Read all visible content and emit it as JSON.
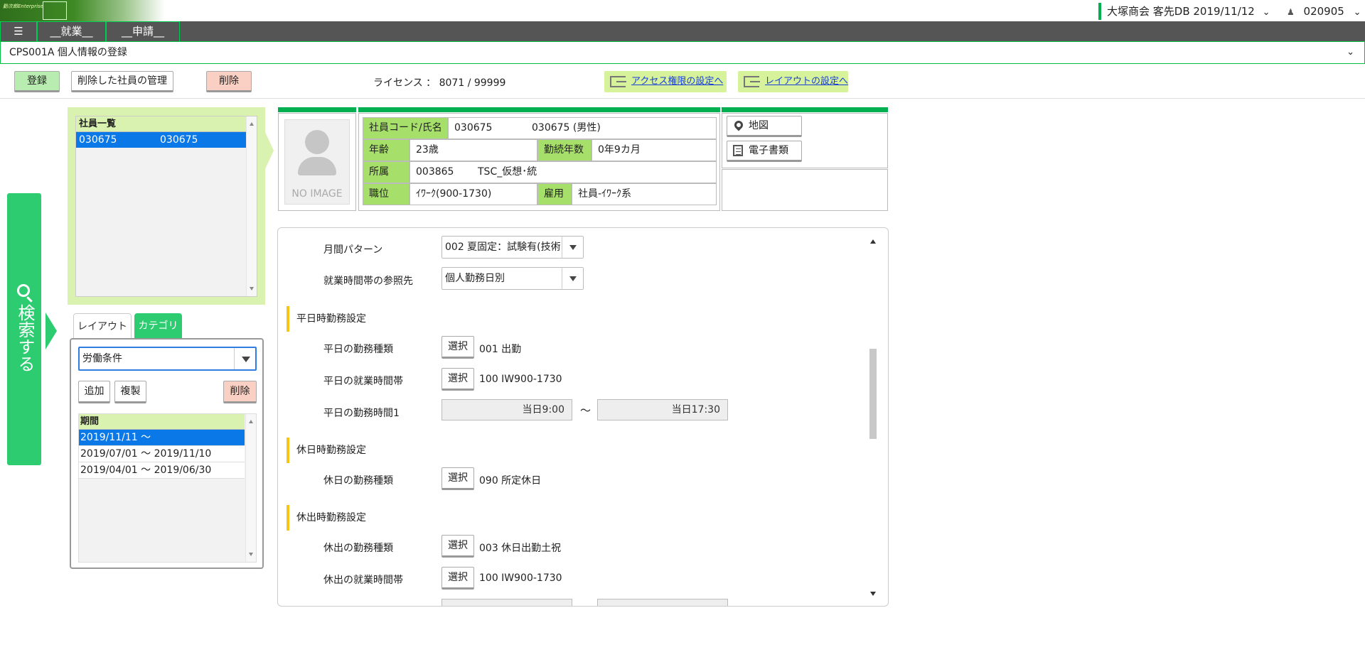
{
  "header": {
    "logo_text": "勤次郎Enterprise",
    "company": "大塚商会 客先DB 2019/11/12",
    "company_chevron": "⌄",
    "user_id": "020905",
    "user_chevron": "⌄"
  },
  "menu": {
    "hamburger": "☰",
    "items": [
      "__就業__",
      "__申請__"
    ]
  },
  "screen": {
    "title": "CPS001A 個人情報の登録",
    "chevron": "⌄"
  },
  "toolbar": {
    "register": "登録",
    "deleted_mgmt": "削除した社員の管理",
    "delete": "削除",
    "license": "ライセンス ： 8071 / 99999",
    "access_link": "アクセス権限の設定へ",
    "layout_link": "レイアウトの設定へ"
  },
  "search": {
    "label": "検索する"
  },
  "employee_list": {
    "header": "社員一覧",
    "rows": [
      {
        "code": "030675",
        "name": "030675"
      }
    ]
  },
  "category": {
    "tab_layout": "レイアウト",
    "tab_category": "カテゴリ",
    "selected": "労働条件",
    "add": "追加",
    "copy": "複製",
    "delete": "削除",
    "period_header": "期間",
    "periods": [
      "2019/11/11 ～",
      "2019/07/01 ～ 2019/11/10",
      "2019/04/01 ～ 2019/06/30"
    ]
  },
  "employee_info": {
    "photo_placeholder": "NO IMAGE",
    "code_name_label": "社員コード/氏名",
    "code": "030675",
    "name": "030675 (男性)",
    "age_label": "年齢",
    "age": "23歳",
    "tenure_label": "勤続年数",
    "tenure": "0年9カ月",
    "dept_label": "所属",
    "dept_code": "003865",
    "dept_name": "TSC_仮想･統",
    "position_label": "職位",
    "position": "ｲﾜｰｸ(900-1730)",
    "employment_label": "雇用",
    "employment": "社員-ｲﾜｰｸ系",
    "map_button": "地図",
    "documents_button": "電子書類"
  },
  "settings": {
    "monthly_pattern_label": "月間パターン",
    "monthly_pattern_value": "002  夏固定：試験有(技術",
    "ref_label": "就業時間帯の参照先",
    "ref_value": "個人勤務日別",
    "weekday_section": "平日時勤務設定",
    "weekday_type_label": "平日の勤務種類",
    "weekday_type_value": "001  出勤",
    "weekday_time_label": "平日の就業時間帯",
    "weekday_time_value": "100  IW900-1730",
    "weekday_hours_label": "平日の勤務時間1",
    "weekday_start": "当日9:00",
    "tilde": "～",
    "weekday_end": "当日17:30",
    "holiday_section": "休日時勤務設定",
    "holiday_type_label": "休日の勤務種類",
    "holiday_type_value": "090  所定休日",
    "holiday_work_section": "休出時勤務設定",
    "holiday_work_type_label": "休出の勤務種類",
    "holiday_work_type_value": "003  休日出勤土祝",
    "holiday_work_time_label": "休出の就業時間帯",
    "holiday_work_time_value": "100  IW900-1730",
    "select_button": "選択"
  }
}
